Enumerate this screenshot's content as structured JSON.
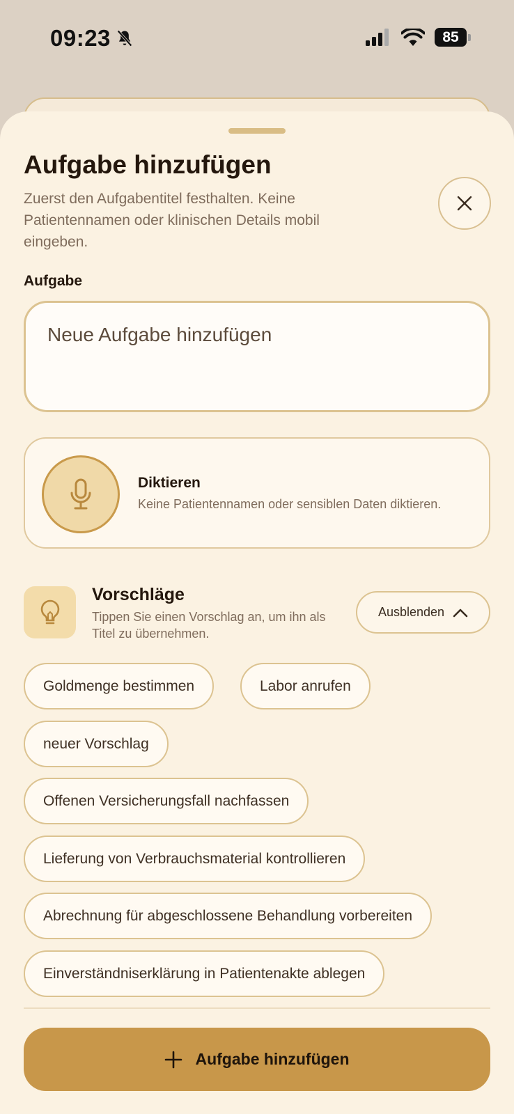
{
  "status_bar": {
    "time": "09:23",
    "battery": "85"
  },
  "sheet": {
    "title": "Aufgabe hinzufügen",
    "subtitle": "Zuerst den Aufgabentitel festhalten. Keine Patientennamen oder klinischen Details mobil eingeben."
  },
  "task_field": {
    "label": "Aufgabe",
    "placeholder": "Neue Aufgabe hinzufügen",
    "value": ""
  },
  "dictate": {
    "title": "Diktieren",
    "subtitle": "Keine Patientennamen oder sensiblen Daten diktieren."
  },
  "suggestions": {
    "title": "Vorschläge",
    "subtitle": "Tippen Sie einen Vorschlag an, um ihn als Titel zu übernehmen.",
    "hide_label": "Ausblenden",
    "items": [
      "Goldmenge bestimmen",
      "Labor anrufen",
      "neuer Vorschlag",
      "Offenen Versicherungsfall nachfassen",
      "Lieferung von Verbrauchsmaterial kontrollieren",
      "Abrechnung für abgeschlossene Behandlung vorbereiten",
      "Einverständniserklärung in Patientenakte ablegen"
    ]
  },
  "submit": {
    "label": "Aufgabe hinzufügen"
  },
  "colors": {
    "accent": "#c8974a",
    "sheet_background": "#fbf2e2",
    "border": "#dcc391"
  }
}
